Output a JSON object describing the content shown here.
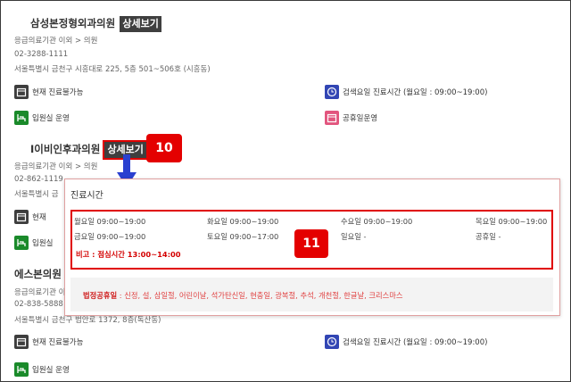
{
  "entries": [
    {
      "name": "삼성본정형외과의원",
      "detail_label": "상세보기",
      "category": "응급의료기관 이외 > 의원",
      "phone": "02-3288-1111",
      "address": "서울특별시 금천구 시흥대로 225, 5층 501~506호 (시흥동)",
      "status": "현재 진료불가능",
      "search_day": "검색요일 진료시간 (월요일 : 09:00~19:00)",
      "ward": "입원실 운영",
      "holiday": "공휴일운영"
    },
    {
      "name": "I이비인후과의원",
      "detail_label": "상세보기",
      "category": "응급의료기관 이외 > 의원",
      "phone": "02-862-1119",
      "address": "서울특별시 금",
      "status": "현재",
      "ward": "입원실"
    },
    {
      "name": "에스본의원",
      "category": "응급의료기관 이외 > 의원",
      "phone": "02-838-5888",
      "address": "서울특별시 금천구 범안로 1372, 8층(독산동)",
      "status": "현재 진료불가능",
      "search_day": "검색요일 진료시간 (월요일 : 09:00~19:00)",
      "ward": "입원실 운영"
    }
  ],
  "popup": {
    "title": "진료시간",
    "days": [
      "월요일 09:00~19:00",
      "화요일 09:00~19:00",
      "수요일 09:00~19:00",
      "목요일 09:00~19:00",
      "금요일 09:00~19:00",
      "토요일 09:00~17:00",
      "일요일 -",
      "공휴일 -"
    ],
    "note": "비고 : 점심시간 13:00~14:00",
    "holiday_label": "법정공휴일",
    "holiday_list": " : 신정, 설, 삼일절, 어린이날, 석가탄신일, 현충일, 광복절, 추석, 개천절, 한글날, 크리스마스"
  },
  "callouts": {
    "first": "10",
    "second": "11"
  },
  "colors": {
    "callout": "#e40000",
    "tag": "#3f3f3f",
    "holiday_text": "#e04040"
  }
}
